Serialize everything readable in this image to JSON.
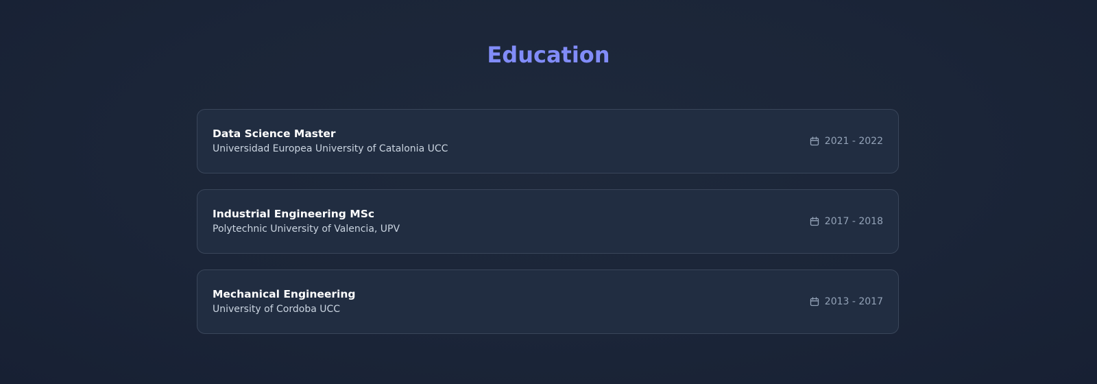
{
  "section": {
    "title": "Education"
  },
  "education": [
    {
      "degree": "Data Science Master",
      "school": "Universidad Europea University of Catalonia UCC",
      "period": "2021 - 2022",
      "icon": "calendar-icon"
    },
    {
      "degree": "Industrial Engineering MSc",
      "school": "Polytechnic University of Valencia, UPV",
      "period": "2017 - 2018",
      "icon": "calendar-icon"
    },
    {
      "degree": "Mechanical Engineering",
      "school": "University of Cordoba UCC",
      "period": "2013 - 2017",
      "icon": "calendar-icon"
    }
  ],
  "colors": {
    "accent": "#818cf8",
    "background": "#1b2538",
    "card": "#212d41",
    "card_border": "#3a465a"
  }
}
